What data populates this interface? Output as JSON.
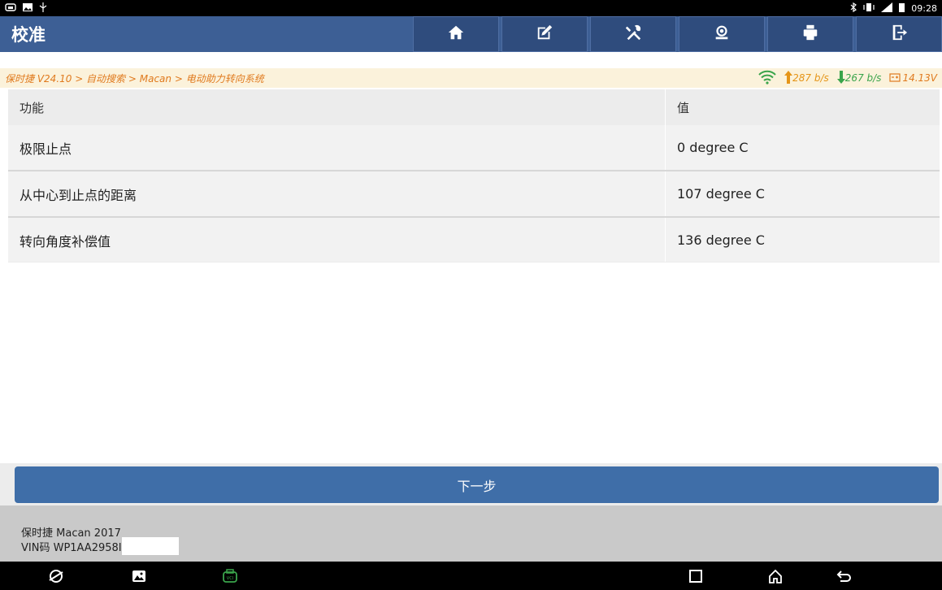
{
  "status_bar": {
    "time": "09:28"
  },
  "header": {
    "title": "校准",
    "toolbar": [
      {
        "name": "home-icon"
      },
      {
        "name": "edit-icon"
      },
      {
        "name": "tools-icon"
      },
      {
        "name": "support-icon"
      },
      {
        "name": "print-icon"
      },
      {
        "name": "exit-icon"
      }
    ]
  },
  "breadcrumb": "保时捷 V24.10 > 自动搜索 > Macan > 电动助力转向系统",
  "network": {
    "upload": "287 b/s",
    "download": "267 b/s",
    "voltage": "14.13V"
  },
  "table": {
    "headers": {
      "function": "功能",
      "value": "值"
    },
    "rows": [
      {
        "function": "极限止点",
        "value": "0 degree C"
      },
      {
        "function": "从中心到止点的距离",
        "value": "107 degree C"
      },
      {
        "function": "转向角度补偿值",
        "value": "136 degree C"
      }
    ]
  },
  "next_button": "下一步",
  "vehicle": {
    "model": "保时捷 Macan 2017",
    "vin": "VIN码 WP1AA2958I"
  },
  "colors": {
    "title_bar": "#3d5f95",
    "button": "#3f6ea8",
    "breadcrumb": "#e07a1e"
  }
}
